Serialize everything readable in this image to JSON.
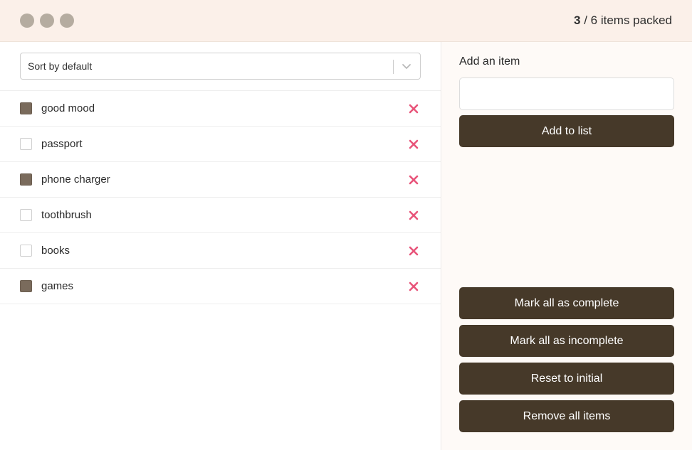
{
  "header": {
    "packed_count": "3",
    "counter_rest": " / 6 items packed"
  },
  "sort": {
    "selected": "Sort by default"
  },
  "items": [
    {
      "label": "good mood",
      "checked": true
    },
    {
      "label": "passport",
      "checked": false
    },
    {
      "label": "phone charger",
      "checked": true
    },
    {
      "label": "toothbrush",
      "checked": false
    },
    {
      "label": "books",
      "checked": false
    },
    {
      "label": "games",
      "checked": true
    }
  ],
  "add_form": {
    "title": "Add an item",
    "input_value": "",
    "submit_label": "Add to list"
  },
  "actions": {
    "mark_complete": "Mark all as complete",
    "mark_incomplete": "Mark all as incomplete",
    "reset": "Reset to initial",
    "remove_all": "Remove all items"
  },
  "colors": {
    "accent_dark": "#463929",
    "checked_box": "#7a6b5c",
    "delete_icon": "#e8547a",
    "header_bg": "#fbf0e9"
  },
  "icons": {
    "delete": "close-x-icon",
    "dropdown": "chevron-down-icon"
  }
}
